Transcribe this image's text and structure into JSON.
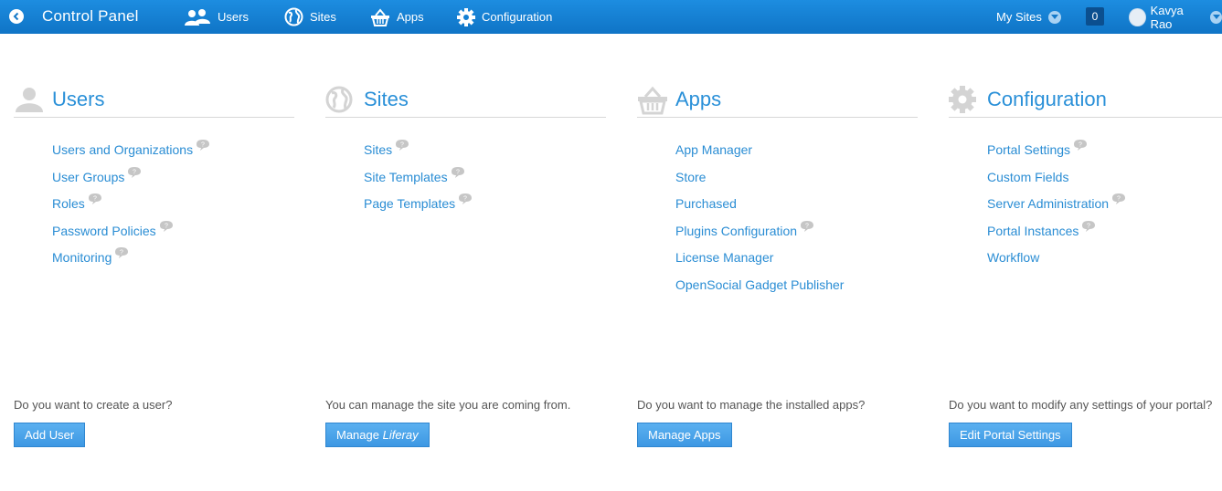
{
  "topbar": {
    "title": "Control Panel",
    "nav": [
      {
        "label": "Users",
        "icon": "users-icon"
      },
      {
        "label": "Sites",
        "icon": "globe-icon"
      },
      {
        "label": "Apps",
        "icon": "basket-icon"
      },
      {
        "label": "Configuration",
        "icon": "gear-icon"
      }
    ],
    "my_sites": "My Sites",
    "notification_count": "0",
    "user_name": "Kavya Rao"
  },
  "columns": [
    {
      "title": "Users",
      "icon": "users-icon",
      "links": [
        {
          "label": "Users and Organizations",
          "help": true
        },
        {
          "label": "User Groups",
          "help": true
        },
        {
          "label": "Roles",
          "help": true
        },
        {
          "label": "Password Policies",
          "help": true
        },
        {
          "label": "Monitoring",
          "help": true
        }
      ],
      "prompt": "Do you want to create a user?",
      "button": {
        "label": "Add User"
      }
    },
    {
      "title": "Sites",
      "icon": "globe-icon",
      "links": [
        {
          "label": "Sites",
          "help": true
        },
        {
          "label": "Site Templates",
          "help": true
        },
        {
          "label": "Page Templates",
          "help": true
        }
      ],
      "prompt": "You can manage the site you are coming from.",
      "button": {
        "label_prefix": "Manage ",
        "label_italic": "Liferay"
      }
    },
    {
      "title": "Apps",
      "icon": "basket-icon",
      "links": [
        {
          "label": "App Manager",
          "help": false
        },
        {
          "label": "Store",
          "help": false
        },
        {
          "label": "Purchased",
          "help": false
        },
        {
          "label": "Plugins Configuration",
          "help": true
        },
        {
          "label": "License Manager",
          "help": false
        },
        {
          "label": "OpenSocial Gadget Publisher",
          "help": false
        }
      ],
      "prompt": "Do you want to manage the installed apps?",
      "button": {
        "label": "Manage Apps"
      }
    },
    {
      "title": "Configuration",
      "icon": "gear-icon",
      "links": [
        {
          "label": "Portal Settings",
          "help": true
        },
        {
          "label": "Custom Fields",
          "help": false
        },
        {
          "label": "Server Administration",
          "help": true
        },
        {
          "label": "Portal Instances",
          "help": true
        },
        {
          "label": "Workflow",
          "help": false
        }
      ],
      "prompt": "Do you want to modify any settings of your portal?",
      "button": {
        "label": "Edit Portal Settings"
      }
    }
  ]
}
